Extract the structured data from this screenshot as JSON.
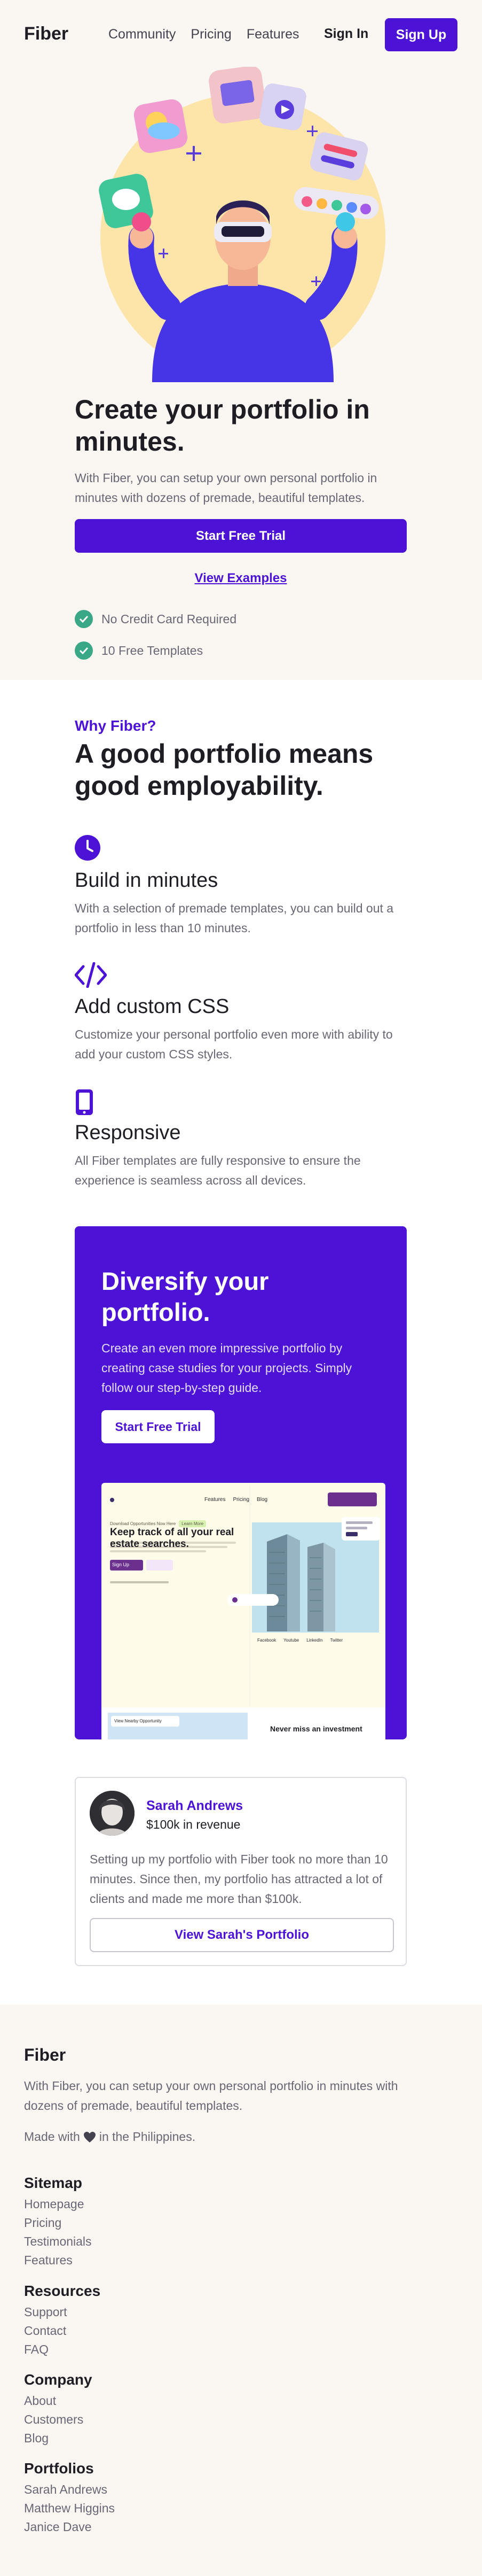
{
  "header": {
    "logo": "Fiber",
    "nav": [
      "Community",
      "Pricing",
      "Features"
    ],
    "signin_label": "Sign In",
    "signup_label": "Sign Up"
  },
  "hero": {
    "title": "Create your portfolio in minutes.",
    "description": "With Fiber, you can setup your own personal portfolio in minutes with dozens of premade, beautiful templates.",
    "primary_cta": "Start Free Trial",
    "secondary_cta": "View Examples",
    "checks": [
      "No Credit Card Required",
      "10 Free Templates"
    ]
  },
  "why": {
    "eyebrow": "Why Fiber?",
    "title": "A good portfolio means good employability.",
    "features": [
      {
        "icon": "clock-icon",
        "title": "Build in minutes",
        "description": "With a selection of premade templates, you can build out a portfolio in less than 10 minutes."
      },
      {
        "icon": "code-icon",
        "title": "Add custom CSS",
        "description": "Customize your personal portfolio even more with ability to add your custom CSS styles."
      },
      {
        "icon": "mobile-icon",
        "title": "Responsive",
        "description": "All Fiber templates are fully responsive to ensure the experience is seamless across all devices."
      }
    ]
  },
  "promo": {
    "title": "Diversify your portfolio.",
    "description": "Create an even more impressive portfolio by creating case studies for your projects. Simply follow our step-by-step guide.",
    "cta": "Start Free Trial",
    "mock": {
      "nav": [
        "Features",
        "Pricing",
        "Blog"
      ],
      "badge": "Download Opportunities Now Here",
      "badge_tag": "Learn More",
      "headline": "Keep track of all your real estate searches.",
      "button": "Sign Up",
      "social": [
        "Facebook",
        "Youtube",
        "LinkedIn",
        "Twitter"
      ],
      "bottom_tag": "View Nearby Opportunity",
      "bottom_headline": "Never miss an investment"
    }
  },
  "testimonial": {
    "name": "Sarah Andrews",
    "revenue": "$100k in revenue",
    "quote": "Setting up my portfolio with Fiber took no more than 10 minutes. Since then, my portfolio has attracted a lot of clients and made me more than $100k.",
    "cta": "View Sarah's Portfolio"
  },
  "footer": {
    "logo": "Fiber",
    "description": "With Fiber, you can setup your own personal portfolio in minutes with dozens of premade, beautiful templates.",
    "made_prefix": "Made with",
    "made_suffix": "in the Philippines.",
    "columns": [
      {
        "title": "Sitemap",
        "links": [
          "Homepage",
          "Pricing",
          "Testimonials",
          "Features"
        ]
      },
      {
        "title": "Resources",
        "links": [
          "Support",
          "Contact",
          "FAQ"
        ]
      },
      {
        "title": "Company",
        "links": [
          "About",
          "Customers",
          "Blog"
        ]
      },
      {
        "title": "Portfolios",
        "links": [
          "Sarah Andrews",
          "Matthew Higgins",
          "Janice Dave"
        ]
      }
    ]
  },
  "colors": {
    "accent": "#4c13d6",
    "check": "#3aa786",
    "hero_bg": "#faf7f3",
    "illustration_circle": "#fde4a8"
  }
}
